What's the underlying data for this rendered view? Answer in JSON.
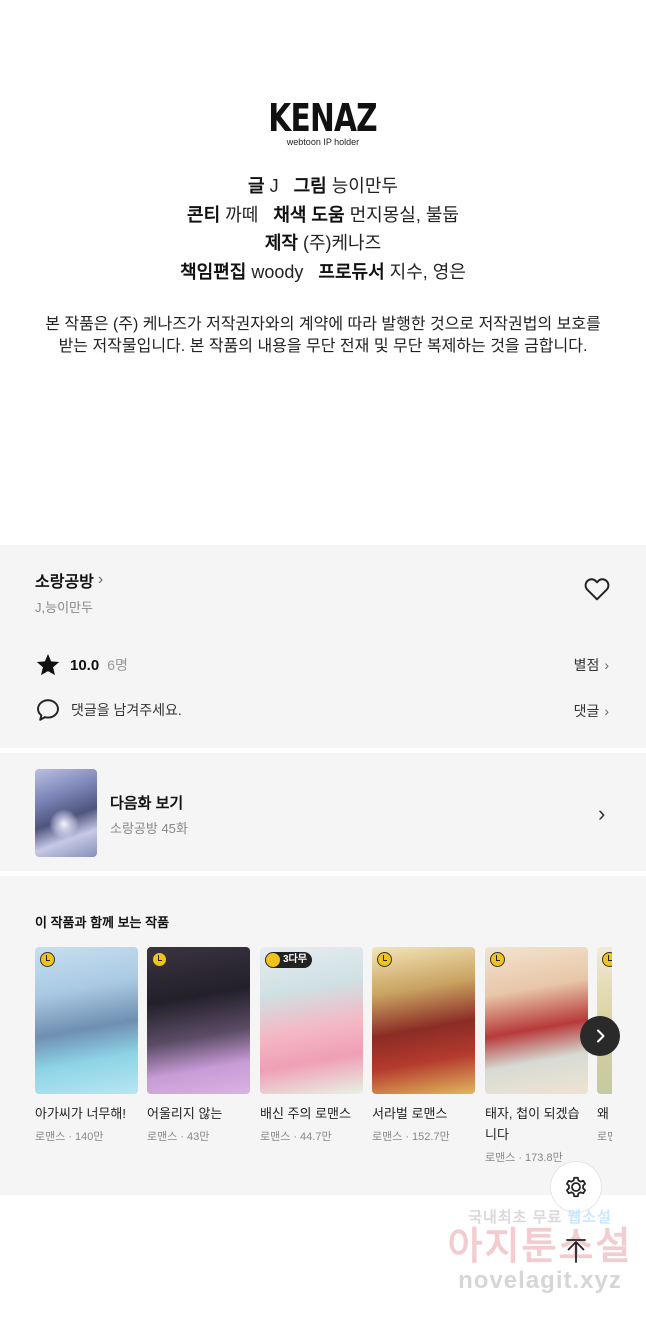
{
  "credits": {
    "logo": "KENAZ",
    "logo_sub": "webtoon IP holder",
    "line1": {
      "k1": "글",
      "v1": "J",
      "k2": "그림",
      "v2": "능이만두"
    },
    "line2": {
      "k1": "콘티",
      "v1": "까떼",
      "k2": "채색 도움",
      "v2": "먼지몽실, 불둡"
    },
    "line3": {
      "k1": "제작",
      "v1": "(주)케나즈"
    },
    "line4": {
      "k1": "책임편집",
      "v1": "woody",
      "k2": "프로듀서",
      "v2": "지수, 영은"
    },
    "notice_1": "본 작품은 (주) 케나즈가 저작권자와의 계약에 따라 발행한 것으로 저작권법의 보호를",
    "notice_2": "받는 저작물입니다. 본 작품의 내용을 무단 전재 및 무단 복제하는 것을 금합니다."
  },
  "series": {
    "title": "소랑공방",
    "authors": "J,능이만두",
    "rating": "10.0",
    "rating_count": "6명",
    "rating_link": "별점",
    "comment_placeholder": "댓글을 남겨주세요.",
    "comment_link": "댓글"
  },
  "next_episode": {
    "label": "다음화 보기",
    "subtitle": "소랑공방 45화"
  },
  "recommendations": {
    "heading": "이 작품과 함께 보는 작품",
    "items": [
      {
        "title": "아가씨가 너무해!",
        "genre": "로맨스",
        "views": "140만",
        "badge": ""
      },
      {
        "title": "어울리지 않는",
        "genre": "로맨스",
        "views": "43만",
        "badge": ""
      },
      {
        "title": "배신 주의 로맨스",
        "genre": "로맨스",
        "views": "44.7만",
        "badge": "3다무"
      },
      {
        "title": "서라벌 로맨스",
        "genre": "로맨스",
        "views": "152.7만",
        "badge": ""
      },
      {
        "title": "태자, 첩이 되겠습니다",
        "genre": "로맨스",
        "views": "173.8만",
        "badge": ""
      },
      {
        "title": "왜",
        "genre": "로맨",
        "views": "",
        "badge": ""
      }
    ]
  },
  "watermark": {
    "line1_a": "국내최초 무료",
    "line1_b": "웹소설",
    "line2": "아지툰소설",
    "line3": "novelagit.xyz"
  },
  "colors": {
    "panel_bg": "#f5f5f5",
    "clock_badge": "#f0c21a",
    "dark_button": "#2a2a2a"
  },
  "icons": [
    "heart-icon",
    "star-icon",
    "comment-icon",
    "chevron-right-icon",
    "clock-icon",
    "gear-icon",
    "arrow-up-icon"
  ]
}
